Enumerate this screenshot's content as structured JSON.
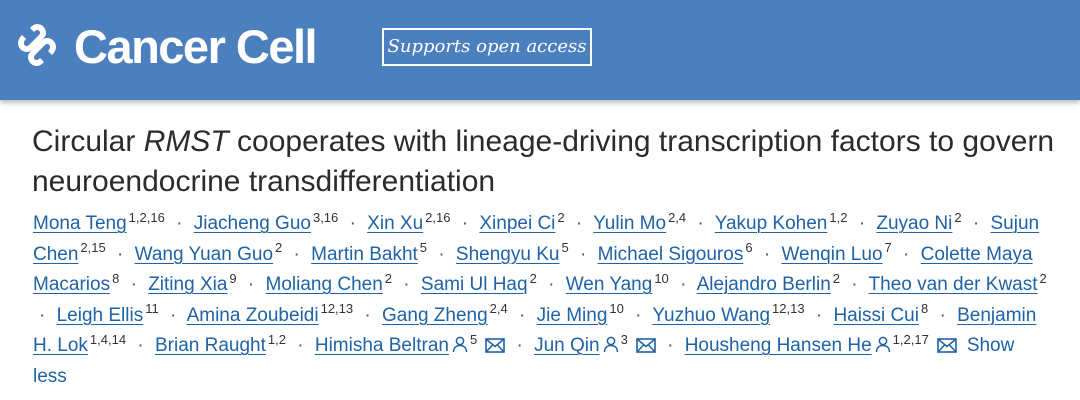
{
  "header": {
    "journal_name": "Cancer Cell",
    "open_access_badge": "Supports open access",
    "brand_color": "#4c7fbe"
  },
  "article": {
    "title_part1": "Circular ",
    "title_italic": "RMST",
    "title_part2": " cooperates with lineage-driving transcription factors to govern neuroendocrine transdifferentiation"
  },
  "authors": {
    "list": [
      {
        "name": "Mona Teng",
        "aff": "1,2,16"
      },
      {
        "name": "Jiacheng Guo",
        "aff": "3,16"
      },
      {
        "name": "Xin Xu",
        "aff": "2,16"
      },
      {
        "name": "Xinpei Ci",
        "aff": "2"
      },
      {
        "name": "Yulin Mo",
        "aff": "2,4"
      },
      {
        "name": "Yakup Kohen",
        "aff": "1,2"
      },
      {
        "name": "Zuyao Ni",
        "aff": "2"
      },
      {
        "name": "Sujun Chen",
        "aff": "2,15"
      },
      {
        "name": "Wang Yuan Guo",
        "aff": "2"
      },
      {
        "name": "Martin Bakht",
        "aff": "5"
      },
      {
        "name": "Shengyu Ku",
        "aff": "5"
      },
      {
        "name": "Michael Sigouros",
        "aff": "6"
      },
      {
        "name": "Wenqin Luo",
        "aff": "7"
      },
      {
        "name": "Colette Maya Macarios",
        "aff": "8"
      },
      {
        "name": "Ziting Xia",
        "aff": "9"
      },
      {
        "name": "Moliang Chen",
        "aff": "2"
      },
      {
        "name": "Sami Ul Haq",
        "aff": "2"
      },
      {
        "name": "Wen Yang",
        "aff": "10"
      },
      {
        "name": "Alejandro Berlin",
        "aff": "2"
      },
      {
        "name": "Theo van der Kwast",
        "aff": "2"
      },
      {
        "name": "Leigh Ellis",
        "aff": "11"
      },
      {
        "name": "Amina Zoubeidi",
        "aff": "12,13"
      },
      {
        "name": "Gang Zheng",
        "aff": "2,4"
      },
      {
        "name": "Jie Ming",
        "aff": "10"
      },
      {
        "name": "Yuzhuo Wang",
        "aff": "12,13"
      },
      {
        "name": "Haissi Cui",
        "aff": "8"
      },
      {
        "name": "Benjamin H. Lok",
        "aff": "1,4,14"
      },
      {
        "name": "Brian Raught",
        "aff": "1,2"
      },
      {
        "name": "Himisha Beltran",
        "aff": "5"
      },
      {
        "name": "Jun Qin",
        "aff": "3"
      },
      {
        "name": "Housheng Hansen He",
        "aff": "1,2,17"
      }
    ],
    "separator": "·",
    "show_less_label": "Show less"
  }
}
